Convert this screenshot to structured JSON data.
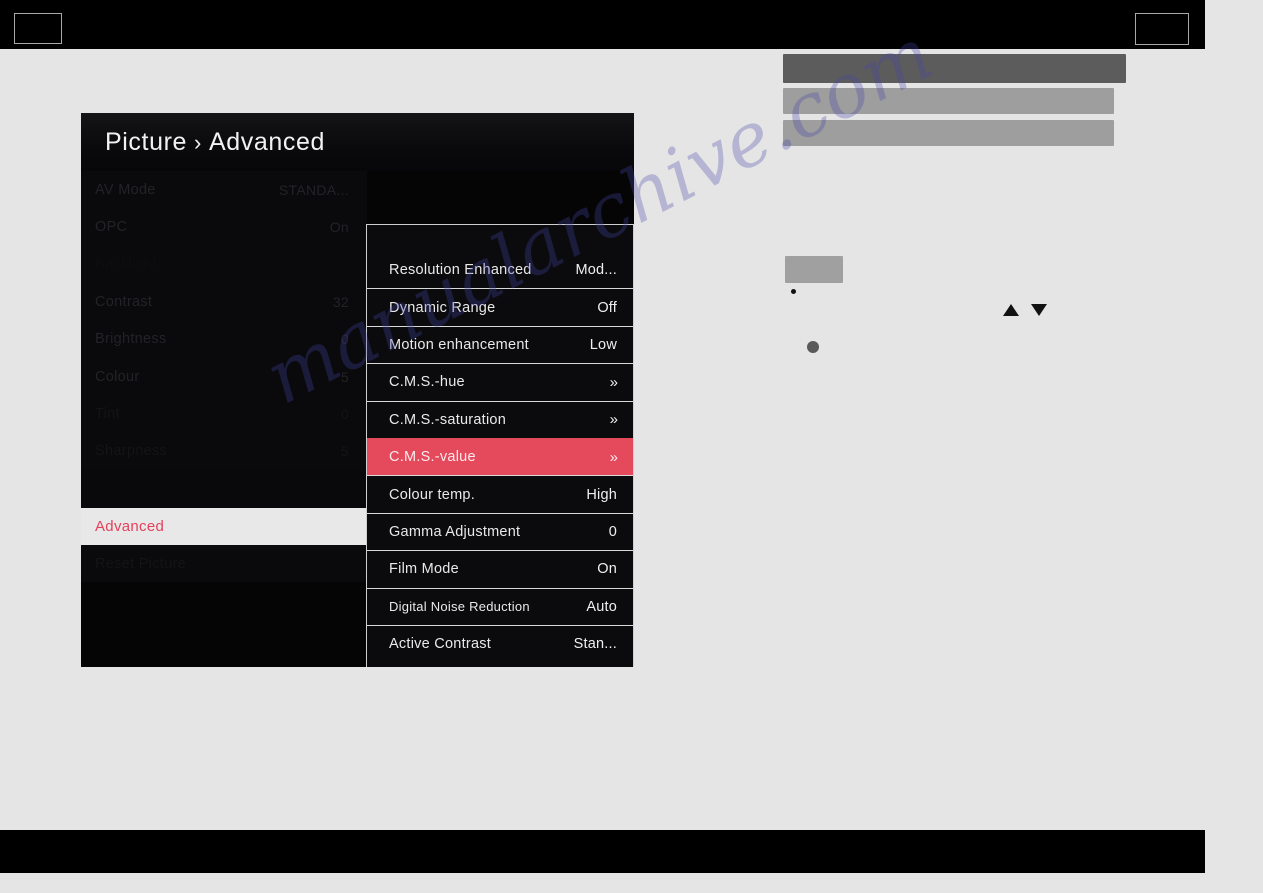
{
  "top_bar": {
    "left_box_label": "",
    "right_box_label": ""
  },
  "osd": {
    "title_root": "Picture",
    "title_separator": "›",
    "title_current": "Advanced",
    "left_menu": [
      {
        "label": "AV Mode",
        "value": "STANDA..."
      },
      {
        "label": "OPC",
        "value": "On"
      },
      {
        "label": "Backlight",
        "value": ""
      },
      {
        "label": "Contrast",
        "value": "32"
      },
      {
        "label": "Brightness",
        "value": "0"
      },
      {
        "label": "Colour",
        "value": "5"
      },
      {
        "label": "Tint",
        "value": "0"
      },
      {
        "label": "Sharpness",
        "value": "5"
      },
      {
        "label": "Advanced",
        "value": "",
        "selected": true
      },
      {
        "label": "Reset Picture",
        "value": ""
      }
    ],
    "submenu": [
      {
        "label": "Resolution Enhanced",
        "value": "Mod..."
      },
      {
        "label": "Dynamic Range",
        "value": "Off"
      },
      {
        "label": "Motion enhancement",
        "value": "Low"
      },
      {
        "label": "C.M.S.-hue",
        "value": "»"
      },
      {
        "label": "C.M.S.-saturation",
        "value": "»"
      },
      {
        "label": "C.M.S.-value",
        "value": "»",
        "highlighted": true
      },
      {
        "label": "Colour temp.",
        "value": "High"
      },
      {
        "label": "Gamma Adjustment",
        "value": "0"
      },
      {
        "label": "Film Mode",
        "value": "On"
      },
      {
        "label": "Digital Noise Reduction",
        "value": "Auto"
      },
      {
        "label": "Active Contrast",
        "value": "Stan..."
      }
    ]
  },
  "watermark": {
    "text": "manualarchive.com"
  },
  "colors": {
    "highlight_red": "#e5495c",
    "selected_bg": "#e8e8e8",
    "panel_bg": "#0b0b0d",
    "bar_dark": "#5c5c5c",
    "bar_light": "#9e9e9e"
  },
  "icons": {
    "arrow_up": "▲",
    "arrow_down": "▼"
  }
}
